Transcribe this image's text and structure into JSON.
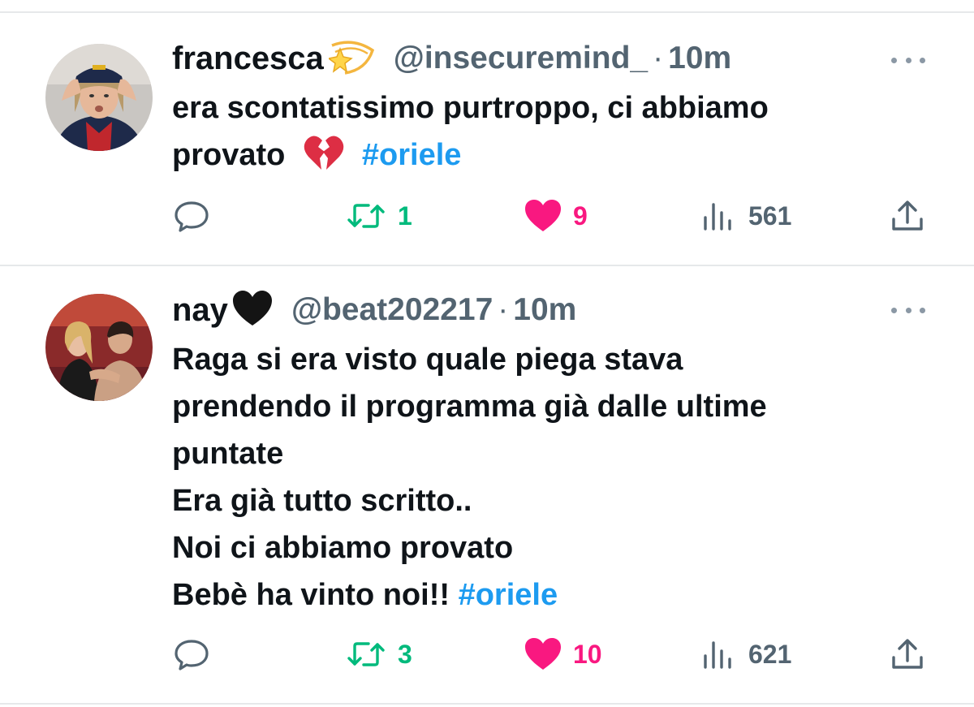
{
  "tweets": [
    {
      "name": "francesca",
      "name_emoji": "dizzy-star-emoji",
      "handle": "@insecuremind_",
      "separator": "·",
      "time": "10m",
      "text_lines": [
        "era scontatissimo purtroppo, ci abbiamo",
        "provato"
      ],
      "text_emoji": "broken-heart-emoji",
      "hashtag": "#oriele",
      "replies": "",
      "retweets": "1",
      "likes": "9",
      "views": "561",
      "liked": true
    },
    {
      "name": "nay",
      "name_emoji": "black-heart-emoji",
      "handle": "@beat202217",
      "separator": "·",
      "time": "10m",
      "text_lines": [
        "Raga si era visto quale piega stava",
        "prendendo il programma già dalle ultime",
        "puntate",
        "Era già tutto scritto..",
        "Noi ci abbiamo provato",
        "Bebè ha vinto noi!!"
      ],
      "hashtag": "#oriele",
      "replies": "",
      "retweets": "3",
      "likes": "10",
      "views": "621",
      "liked": true
    }
  ],
  "colors": {
    "text": "#0f1419",
    "secondary": "#536471",
    "hashtag": "#1d9bf0",
    "retweet": "#00ba7c",
    "like": "#f91880",
    "divider": "#e6e8ea"
  }
}
